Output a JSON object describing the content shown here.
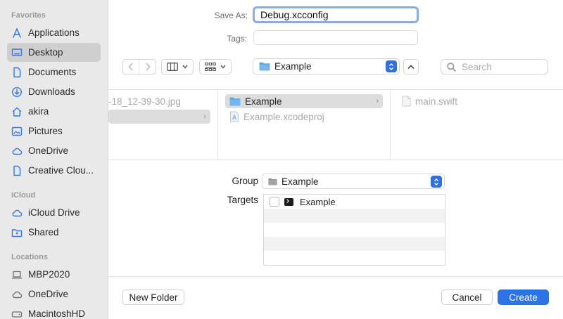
{
  "sidebar": {
    "favorites_title": "Favorites",
    "favorites": [
      {
        "label": "Applications",
        "icon": "applications-icon"
      },
      {
        "label": "Desktop",
        "icon": "desktop-icon",
        "selected": true
      },
      {
        "label": "Documents",
        "icon": "document-icon"
      },
      {
        "label": "Downloads",
        "icon": "download-icon"
      },
      {
        "label": "akira",
        "icon": "home-icon"
      },
      {
        "label": "Pictures",
        "icon": "pictures-icon"
      },
      {
        "label": "OneDrive",
        "icon": "cloud-icon"
      },
      {
        "label": "Creative Clou...",
        "icon": "document-icon"
      }
    ],
    "icloud_title": "iCloud",
    "icloud": [
      {
        "label": "iCloud Drive",
        "icon": "cloud-icon"
      },
      {
        "label": "Shared",
        "icon": "shared-folder-icon"
      }
    ],
    "locations_title": "Locations",
    "locations": [
      {
        "label": "MBP2020",
        "icon": "laptop-icon"
      },
      {
        "label": "OneDrive",
        "icon": "cloud-icon"
      },
      {
        "label": "MacintoshHD",
        "icon": "disk-icon"
      }
    ]
  },
  "save_as": {
    "label": "Save As:",
    "value": "Debug.xcconfig"
  },
  "tags": {
    "label": "Tags:",
    "value": ""
  },
  "toolbar": {
    "location": "Example",
    "search_placeholder": "Search"
  },
  "browser": {
    "col1": [
      "-18_12-39-30.jpg",
      ""
    ],
    "col2": [
      "Example",
      "Example.xcodeproj"
    ],
    "col3": [
      "main.swift"
    ]
  },
  "options": {
    "group_label": "Group",
    "group_value": "Example",
    "targets_label": "Targets",
    "targets": [
      {
        "label": "Example",
        "checked": false
      }
    ]
  },
  "buttons": {
    "new_folder": "New Folder",
    "cancel": "Cancel",
    "create": "Create"
  },
  "colors": {
    "accent": "#2c73e8",
    "focus_ring": "#84aee8",
    "folder": "#5aa5e8"
  }
}
